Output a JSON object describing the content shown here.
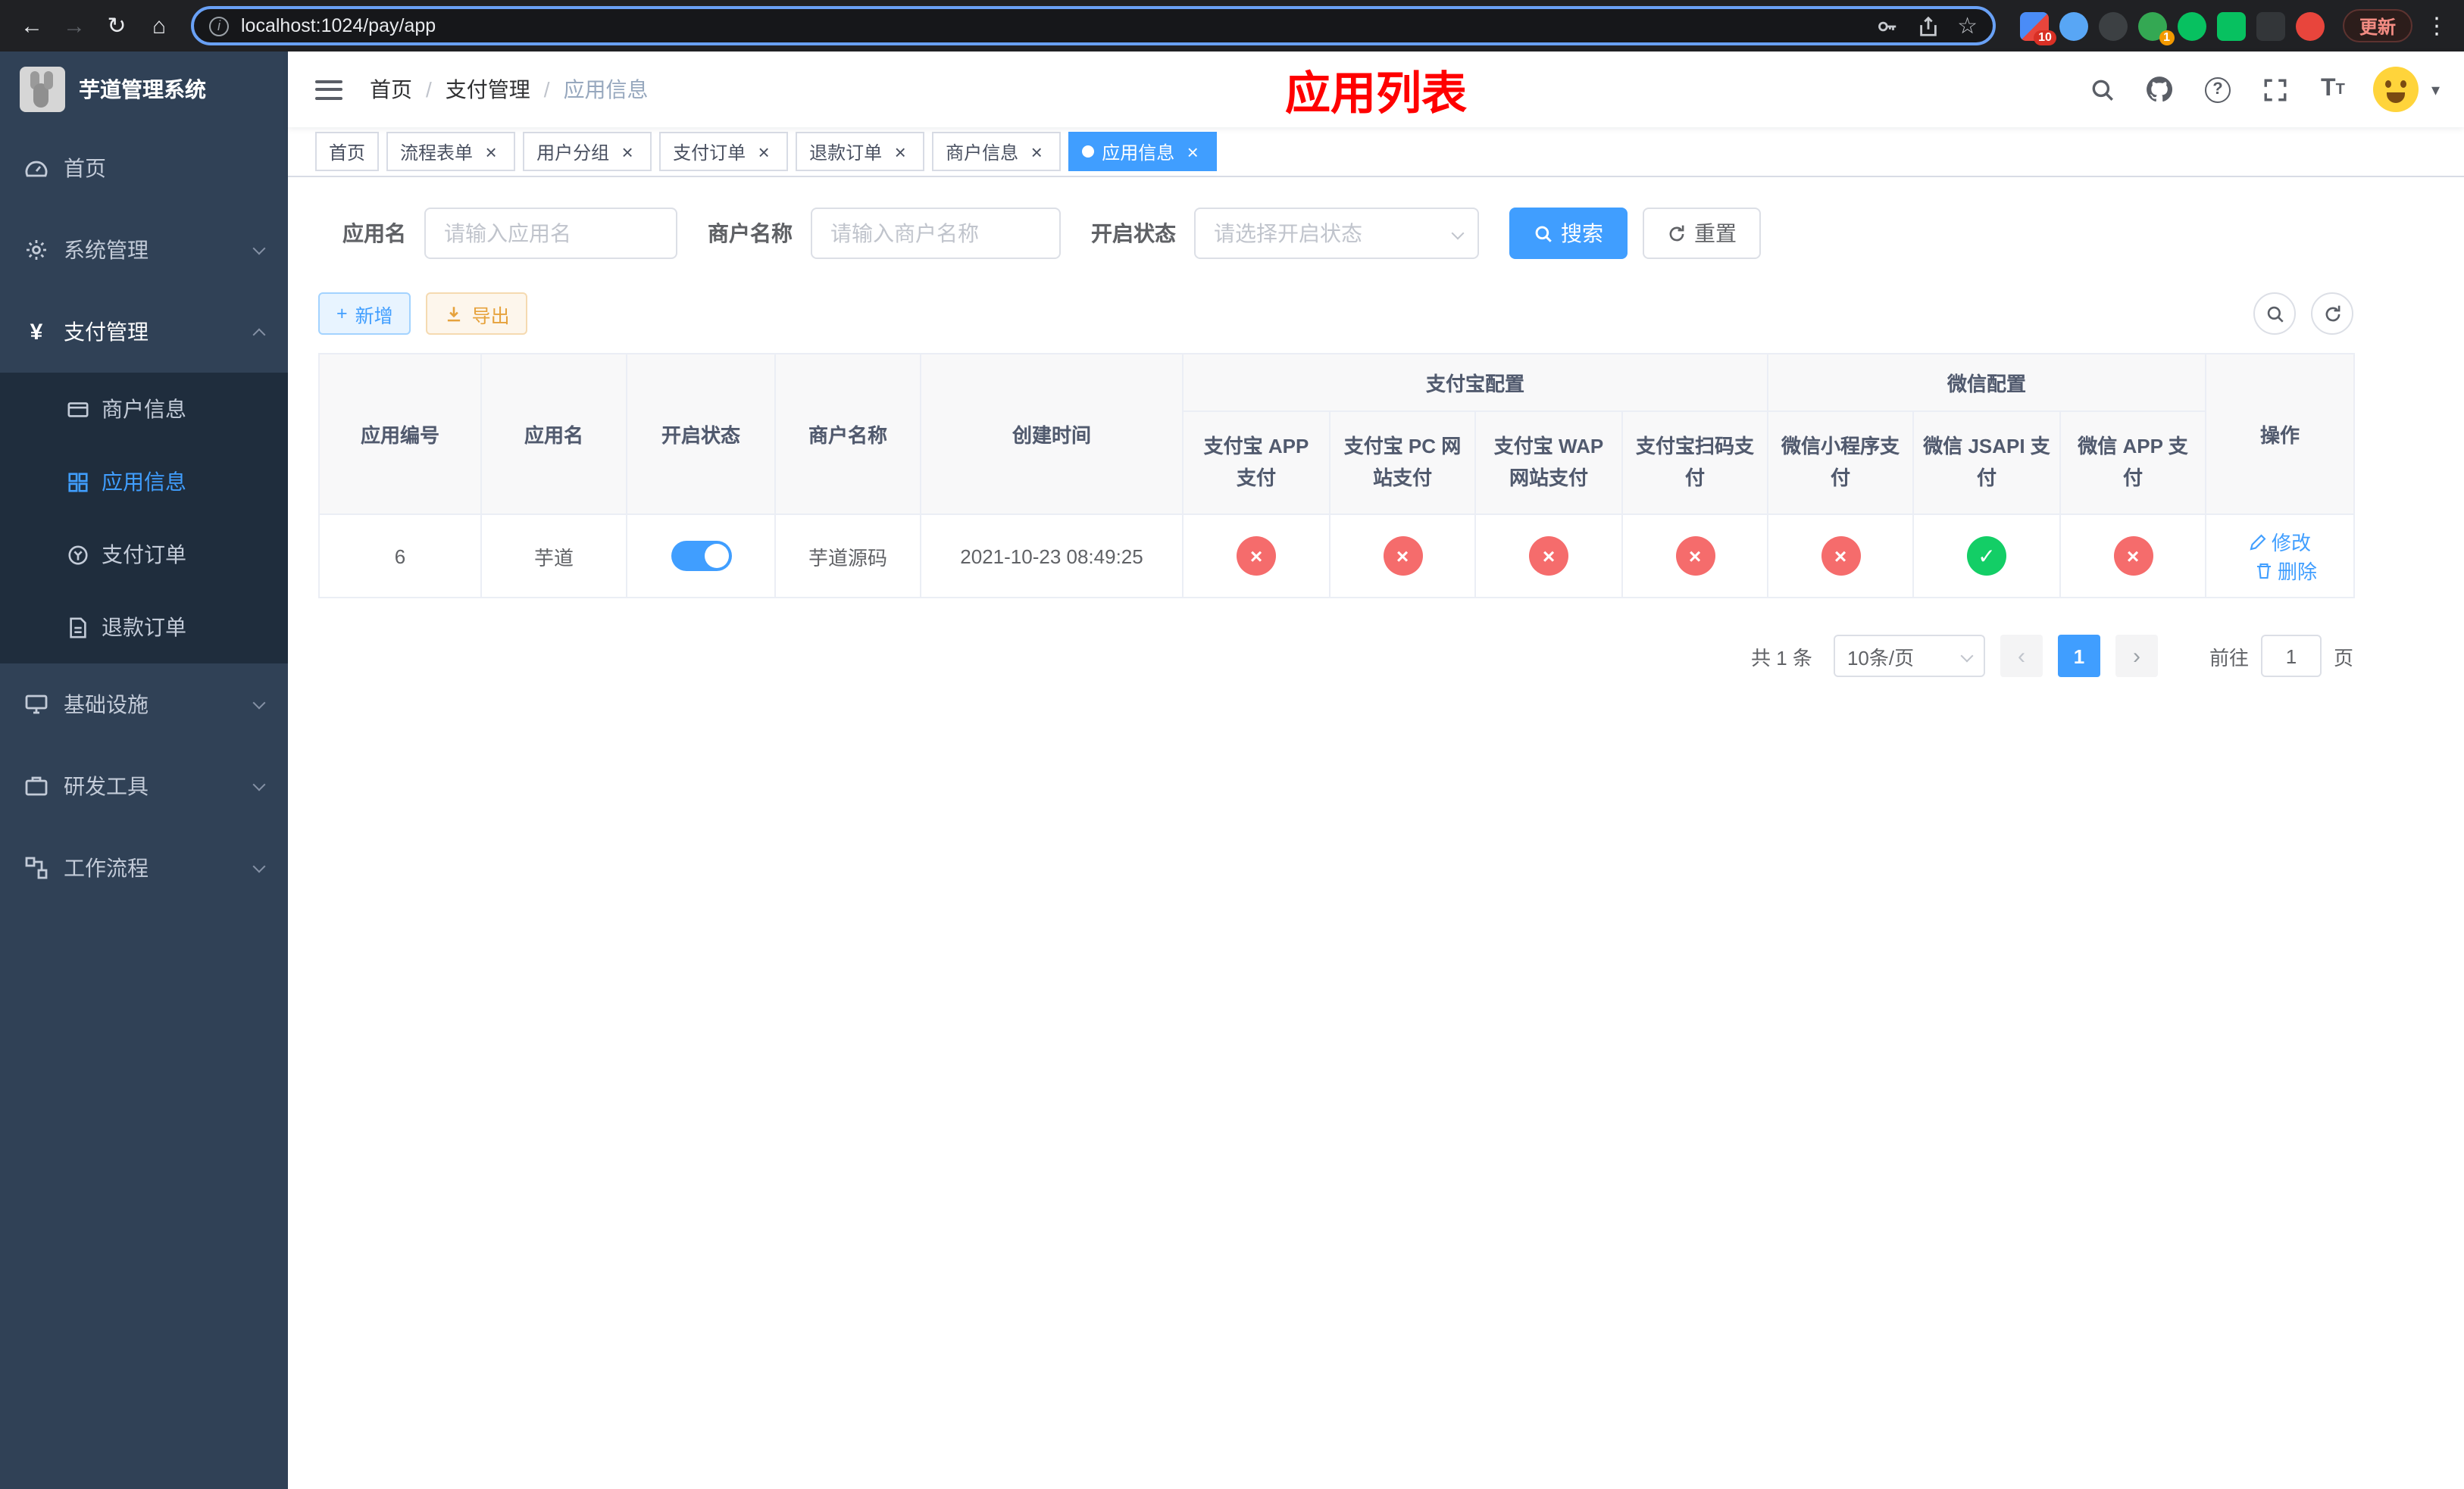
{
  "browser": {
    "url": "localhost:1024/pay/app",
    "update_label": "更新",
    "ext_badge_count": "10",
    "ext_badge_one": "1"
  },
  "icons": {
    "back": "←",
    "forward": "→",
    "reload": "↻",
    "home": "⌂",
    "kebab": "⋮",
    "star": "☆",
    "info": "i",
    "help": "?",
    "plus": "+",
    "close": "×",
    "caret": "▾",
    "prev": "‹",
    "next": "›",
    "check": "✓",
    "cross": "×",
    "yen": "¥",
    "font_big": "T",
    "font_small": "T"
  },
  "sidebar": {
    "title": "芋道管理系统",
    "home": "首页",
    "system": "系统管理",
    "payment": "支付管理",
    "merchant_info": "商户信息",
    "app_info": "应用信息",
    "pay_order": "支付订单",
    "refund_order": "退款订单",
    "infra": "基础设施",
    "dev_tools": "研发工具",
    "workflow": "工作流程"
  },
  "header": {
    "breadcrumb": [
      "首页",
      "支付管理",
      "应用信息"
    ],
    "page_title": "应用列表"
  },
  "tabs": [
    {
      "label": "首页"
    },
    {
      "label": "流程表单"
    },
    {
      "label": "用户分组"
    },
    {
      "label": "支付订单"
    },
    {
      "label": "退款订单"
    },
    {
      "label": "商户信息"
    },
    {
      "label": "应用信息"
    }
  ],
  "filters": {
    "app_name_label": "应用名",
    "app_name_placeholder": "请输入应用名",
    "merchant_label": "商户名称",
    "merchant_placeholder": "请输入商户名称",
    "status_label": "开启状态",
    "status_placeholder": "请选择开启状态",
    "search_label": "搜索",
    "reset_label": "重置"
  },
  "toolbar": {
    "add_label": "新增",
    "export_label": "导出"
  },
  "table": {
    "group_alipay": "支付宝配置",
    "group_wechat": "微信配置",
    "col_app_id": "应用编号",
    "col_app_name": "应用名",
    "col_status": "开启状态",
    "col_merchant": "商户名称",
    "col_created": "创建时间",
    "col_alipay_app": "支付宝 APP 支付",
    "col_alipay_pc": "支付宝 PC 网站支付",
    "col_alipay_wap": "支付宝 WAP 网站支付",
    "col_alipay_qr": "支付宝扫码支付",
    "col_wx_mini": "微信小程序支付",
    "col_wx_jsapi": "微信 JSAPI 支付",
    "col_wx_app": "微信 APP 支付",
    "col_actions": "操作",
    "row": {
      "id": "6",
      "name": "芋道",
      "enabled": true,
      "merchant": "芋道源码",
      "created": "2021-10-23 08:49:25",
      "statuses": [
        "no",
        "no",
        "no",
        "no",
        "no",
        "yes",
        "no"
      ],
      "edit_label": "修改",
      "delete_label": "删除"
    }
  },
  "pagination": {
    "total": "共 1 条",
    "page_size": "10条/页",
    "page": "1",
    "goto_label": "前往",
    "goto_value": "1",
    "page_unit": "页"
  },
  "colors": {
    "primary": "#409eff",
    "danger": "#f56c6c",
    "success": "#13ce66",
    "warning": "#e6a23c",
    "title_red": "#ff0000",
    "sidebar_bg": "#304156",
    "submenu_bg": "#1f2d3d"
  }
}
